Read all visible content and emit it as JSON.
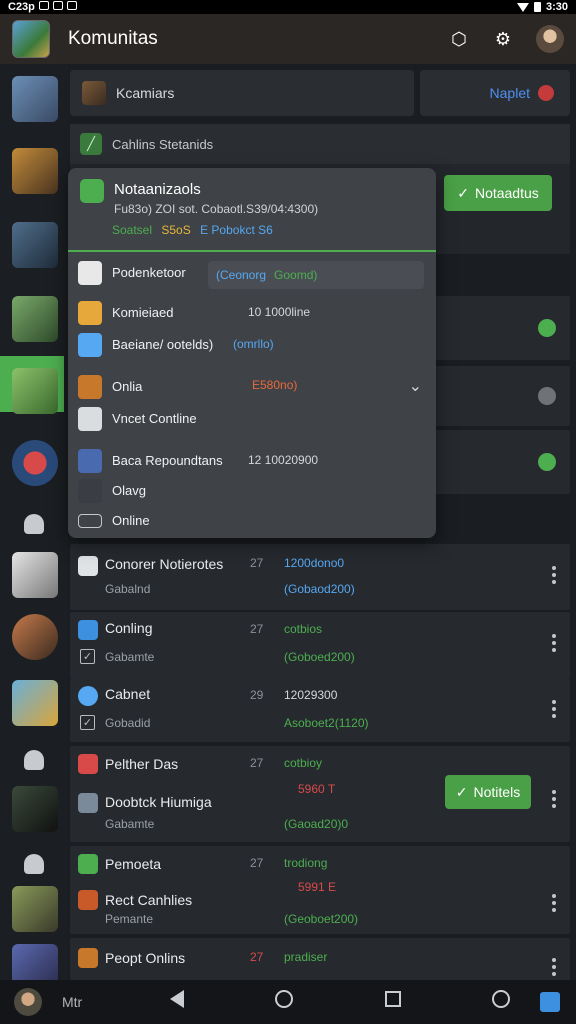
{
  "status": {
    "time": "C23р",
    "right_time": "3:30"
  },
  "appbar": {
    "title": "Komunitas"
  },
  "top": {
    "tab_left": "Kcamiars",
    "tab_right": "Naplet"
  },
  "section": {
    "label": "Cahlins Stetanids"
  },
  "notif_button": "Notaadtus",
  "notif_button_small": "Notitels",
  "dropdown": {
    "title": "Notaanizaols",
    "subtitle": "Fu83o) ZOI sot. Cobaotl.S39/04:4300)",
    "meta_left": "Soatsel",
    "meta_mid": "S5oS",
    "meta_right": "E Pobokct S6",
    "rows": [
      {
        "label": "Podenketoor",
        "pill": "(Ceonorg",
        "pill_right": "Goomd)"
      },
      {
        "label": "Komieiaed",
        "stat": "10  1000line"
      },
      {
        "label": "Baeiane/ ootelds)",
        "link": "(omrllo)"
      },
      {
        "label": "Onlia",
        "orange": "E580no)"
      },
      {
        "label": "Vncet Contline"
      },
      {
        "label": "Baca Repoundtans",
        "stat": "12   10020900"
      },
      {
        "label": "Olavg"
      },
      {
        "label": "Online"
      }
    ]
  },
  "list": [
    {
      "title": "Conorer Notierotes",
      "sub": "Gabalnd",
      "stat": "27",
      "val": "1200dono0",
      "val2": "(Gobaod200)"
    },
    {
      "title": "Conling",
      "sub": "Gabamte",
      "stat": "27",
      "val": "cotbios",
      "val2": "(Goboed200)"
    },
    {
      "title": "Cabnet",
      "sub": "Gobadid",
      "stat": "29",
      "val": "12029300",
      "val2": "Asoboet2(1120)"
    },
    {
      "title": "Pelther Das",
      "sub": "",
      "stat": "27",
      "val": "cotbioy",
      "val2": ""
    },
    {
      "title": "Doobtck Hiumiga",
      "sub": "Gabamte",
      "stat": "",
      "val": "5960 T",
      "val2": "(Gaoad20)0"
    },
    {
      "title": "Pemoeta",
      "sub": "",
      "stat": "27",
      "val": "trodiong",
      "val2": ""
    },
    {
      "title": "Rect Canhlies",
      "sub": "Pemante",
      "stat": "",
      "val": "5991 E",
      "val2": "(Geoboet200)"
    },
    {
      "title": "Peopt Onlins",
      "sub": "",
      "stat": "27",
      "val": "pradiser",
      "val2": ""
    }
  ],
  "navbar": {
    "label": "Mtr"
  },
  "colors": {
    "accent": "#4cae4f",
    "link": "#56a8f2",
    "danger": "#c43b3b"
  }
}
